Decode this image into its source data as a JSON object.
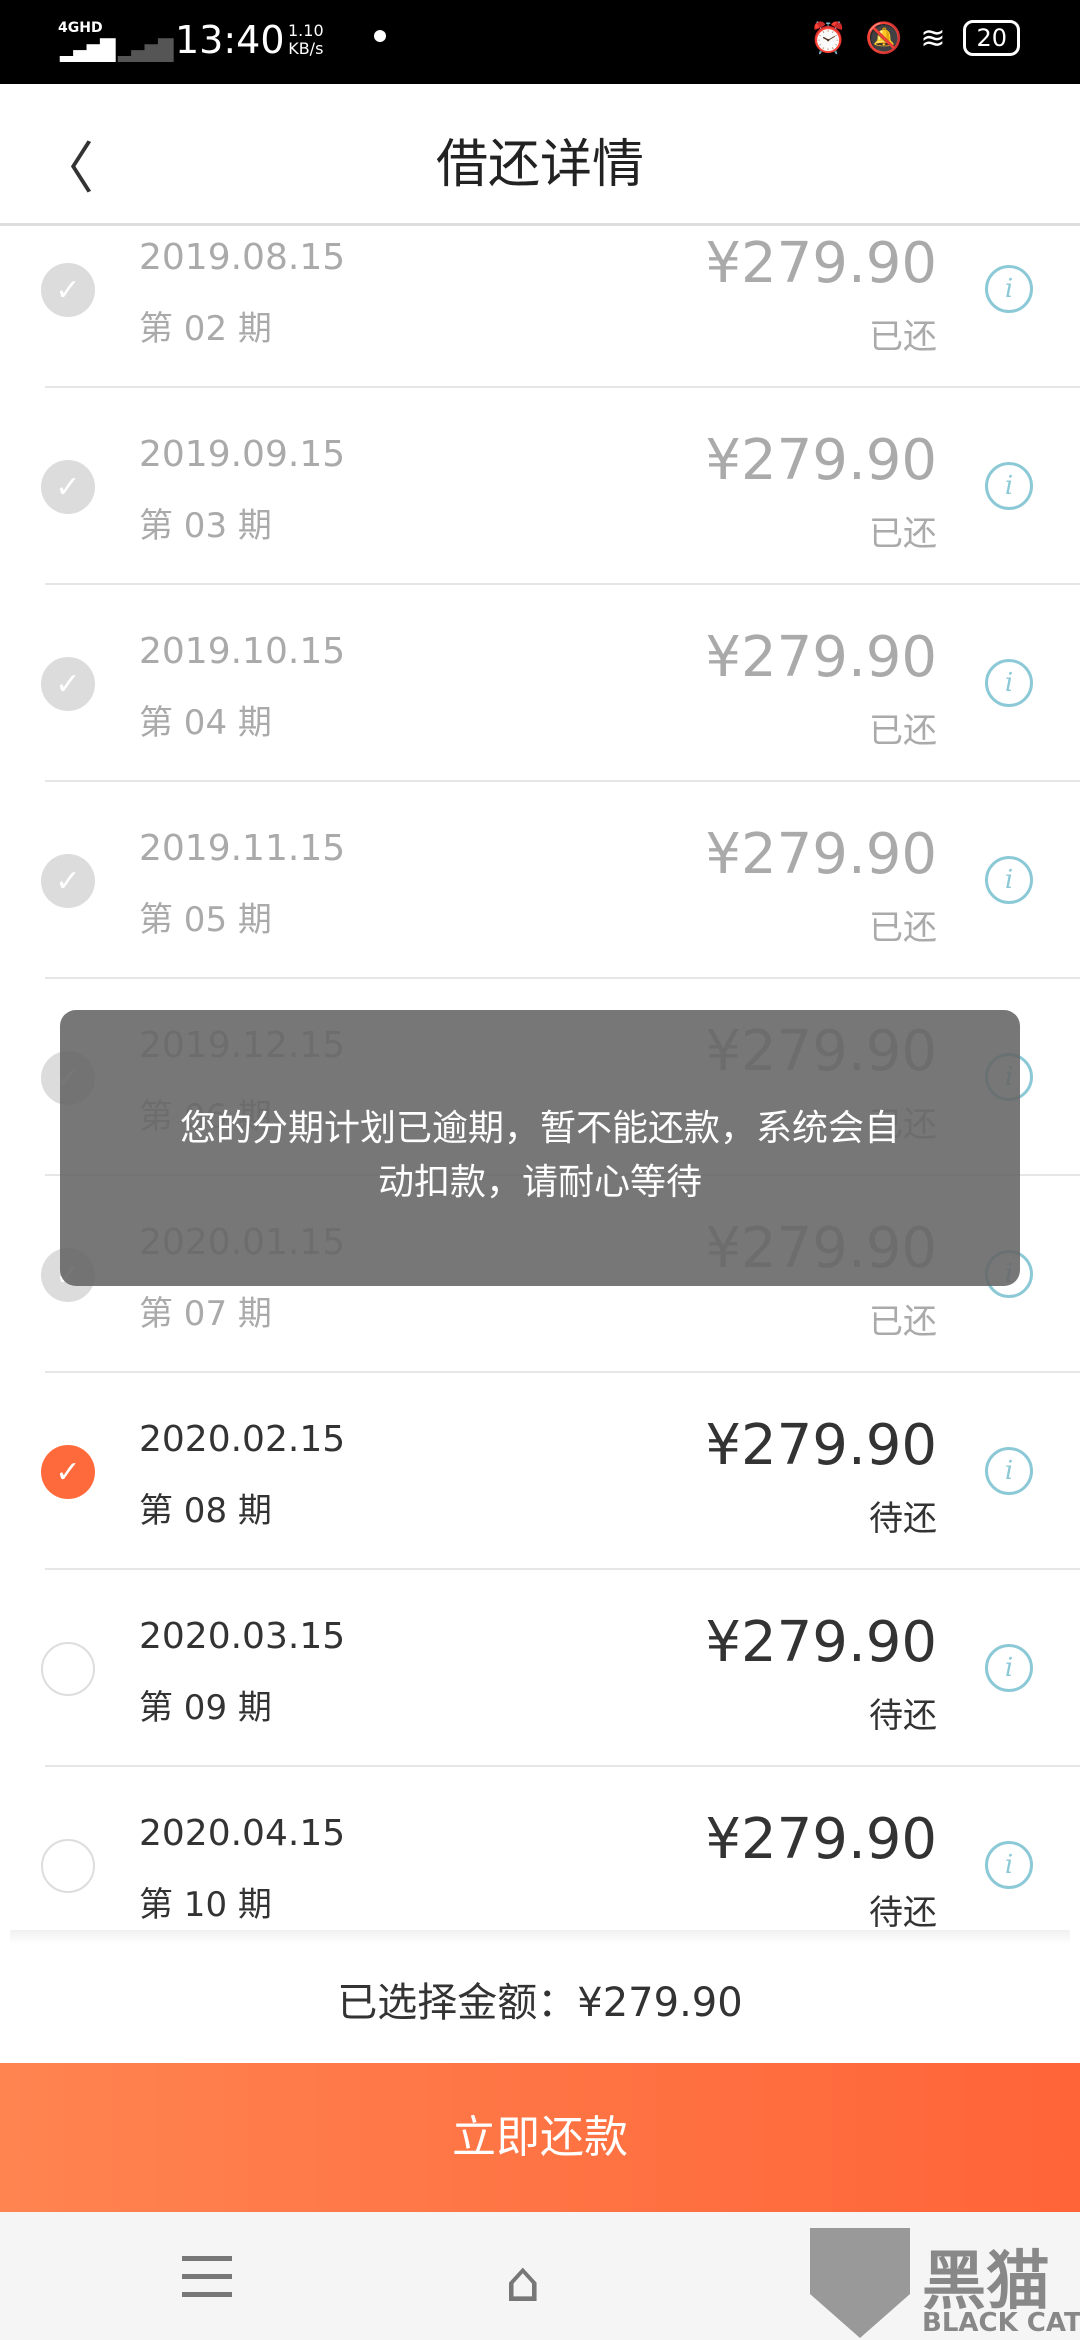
{
  "status_bar": {
    "network": "4GHD",
    "time": "13:40",
    "speed_value": "1.10",
    "speed_unit": "KB/s",
    "battery": "20"
  },
  "header": {
    "title": "借还详情"
  },
  "installments": [
    {
      "date": "2019.08.15",
      "period": "第 02 期",
      "amount": "¥279.90",
      "status": "已还",
      "state": "paid"
    },
    {
      "date": "2019.09.15",
      "period": "第 03 期",
      "amount": "¥279.90",
      "status": "已还",
      "state": "paid"
    },
    {
      "date": "2019.10.15",
      "period": "第 04 期",
      "amount": "¥279.90",
      "status": "已还",
      "state": "paid"
    },
    {
      "date": "2019.11.15",
      "period": "第 05 期",
      "amount": "¥279.90",
      "status": "已还",
      "state": "paid"
    },
    {
      "date": "2019.12.15",
      "period": "第 06 期",
      "amount": "¥279.90",
      "status": "已还",
      "state": "paid"
    },
    {
      "date": "2020.01.15",
      "period": "第 07 期",
      "amount": "¥279.90",
      "status": "已还",
      "state": "paid"
    },
    {
      "date": "2020.02.15",
      "period": "第 08 期",
      "amount": "¥279.90",
      "status": "待还",
      "state": "selected"
    },
    {
      "date": "2020.03.15",
      "period": "第 09 期",
      "amount": "¥279.90",
      "status": "待还",
      "state": "unselected"
    },
    {
      "date": "2020.04.15",
      "period": "第 10 期",
      "amount": "¥279.90",
      "status": "待还",
      "state": "unselected"
    }
  ],
  "summary": {
    "text": "已选择金额：¥279.90"
  },
  "pay_button": {
    "label": "立即还款"
  },
  "toast": {
    "message": "您的分期计划已逾期，暂不能还款，系统会自动扣款，请耐心等待"
  },
  "watermark": {
    "cn": "黑猫",
    "en": "BLACK CAT"
  },
  "colors": {
    "accent": "#ff6a3d",
    "info": "#8cc9d6"
  }
}
